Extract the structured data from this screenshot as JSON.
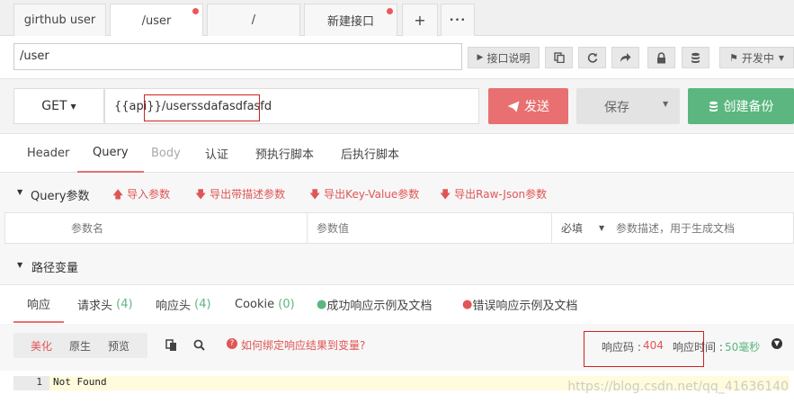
{
  "tabs": [
    {
      "label": "girthub user",
      "unsaved": false
    },
    {
      "label": "/user",
      "unsaved": true
    },
    {
      "label": "/",
      "unsaved": false
    },
    {
      "label": "新建接口",
      "unsaved": true
    }
  ],
  "tab_add": "+",
  "tab_more": "•••",
  "url_row": {
    "path": "/user",
    "doc_button": "接口说明",
    "status_button": "开发中"
  },
  "request": {
    "method": "GET",
    "url_prefix": "{{api}}",
    "url_path": "/userssdafasdfasfd",
    "send": "发送",
    "save": "保存",
    "backup": "创建备份"
  },
  "param_tabs": [
    "Header",
    "Query",
    "Body",
    "认证",
    "预执行脚本",
    "后执行脚本"
  ],
  "query": {
    "title": "Query参数",
    "import": "导入参数",
    "export_desc": "导出带描述参数",
    "export_kv": "导出Key-Value参数",
    "export_json": "导出Raw-Json参数",
    "col_name": "参数名",
    "col_value": "参数值",
    "col_required": "必填",
    "col_desc": "参数描述，用于生成文档",
    "path_title": "路径变量"
  },
  "response_tabs": {
    "resp": "响应",
    "req_headers": "请求头",
    "req_headers_count": "(4)",
    "resp_headers": "响应头",
    "resp_headers_count": "(4)",
    "cookie": "Cookie",
    "cookie_count": "(0)",
    "success_doc": "成功响应示例及文档",
    "error_doc": "错误响应示例及文档"
  },
  "response_bar": {
    "beautify": "美化",
    "raw": "原生",
    "preview": "预览",
    "bind_help": "如何绑定响应结果到变量?",
    "status_label": "响应码 :",
    "status_code": "404",
    "time_label": "响应时间 :",
    "time_value": "50毫秒"
  },
  "code": {
    "line_number": "1",
    "line_text": "Not Found"
  },
  "watermark": "https://blog.csdn.net/qq_41636140",
  "colors": {
    "accent_red": "#e87070",
    "green": "#5bb77f",
    "link_red": "#e05555"
  }
}
